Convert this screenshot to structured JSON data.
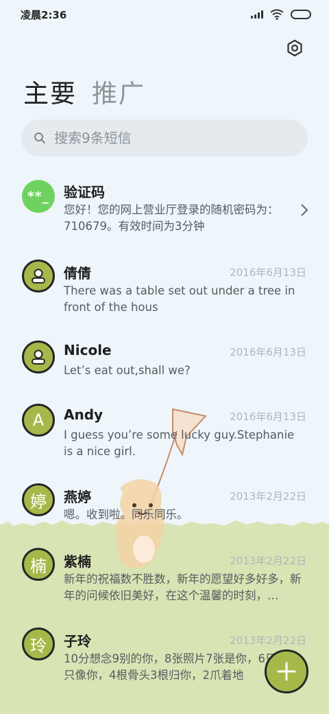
{
  "status_bar": {
    "time": "凌晨2:36"
  },
  "tabs": [
    {
      "label": "主要",
      "active": true
    },
    {
      "label": "推广",
      "active": false
    }
  ],
  "search": {
    "placeholder": "搜索9条短信"
  },
  "messages": [
    {
      "sender": "验证码",
      "avatar_text": "**_",
      "date": "",
      "preview": "您好！您的网上营业厅登录的随机密码为：710679。有效时间为3分钟"
    },
    {
      "sender": "倩倩",
      "avatar_icon": "person-icon",
      "date": "2016年6月13日",
      "preview": "There was a table set out under a tree in front of the hous"
    },
    {
      "sender": "Nicole",
      "avatar_icon": "person-icon",
      "date": "2016年6月13日",
      "preview": "Let’s eat out,shall we?"
    },
    {
      "sender": "Andy",
      "avatar_text": "A",
      "date": "2016年6月13日",
      "preview": "I guess you’re some lucky guy.Stephanie is a nice girl."
    },
    {
      "sender": "燕婷",
      "avatar_text": "婷",
      "date": "2013年2月22日",
      "preview": "嗯。收到啦。同乐同乐。"
    },
    {
      "sender": "紫楠",
      "avatar_text": "楠",
      "date": "2013年2月22日",
      "preview": "新年的祝福数不胜数，新年的愿望好多好多，新年的问候依旧美好，在这个温馨的时刻，…"
    },
    {
      "sender": "子玲",
      "avatar_text": "玲",
      "date": "2013年2月22日",
      "preview": "10分想念9别的你，8张照片7张是你，6只狗5只像你，4根骨头3根归你，2爪着地"
    }
  ],
  "colors": {
    "accent": "#a5b94a",
    "green_avatar": "#6ed35e",
    "grass": "#d8e4b4",
    "background": "#eef6fb"
  }
}
